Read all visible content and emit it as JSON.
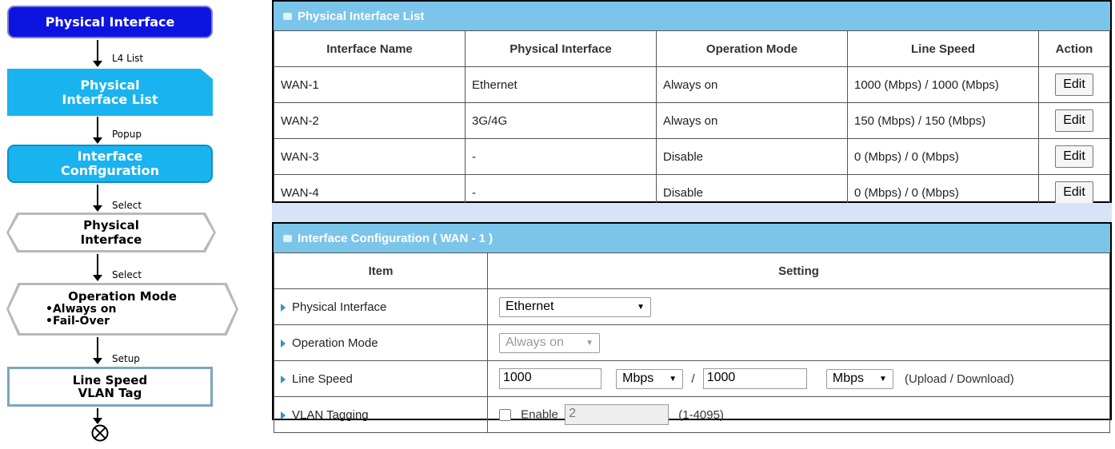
{
  "flow": {
    "step1": "Physical Interface",
    "arrow1": "L4 List",
    "step2_line1": "Physical",
    "step2_line2": "Interface List",
    "arrow2": "Popup",
    "step3_line1": "Interface",
    "step3_line2": "Configuration",
    "arrow3": "Select",
    "step4_line1": "Physical",
    "step4_line2": "Interface",
    "arrow4": "Select",
    "step5_line1": "Operation Mode",
    "step5_bullet1": "•Always on",
    "step5_bullet2": "•Fail-Over",
    "arrow5": "Setup",
    "step6_line1": "Line Speed",
    "step6_line2": "VLAN Tag"
  },
  "list_panel": {
    "title": "Physical Interface List",
    "columns": [
      "Interface Name",
      "Physical Interface",
      "Operation Mode",
      "Line Speed",
      "Action"
    ],
    "rows": [
      {
        "name": "WAN-1",
        "physical": "Ethernet",
        "mode": "Always on",
        "speed": "1000 (Mbps) / 1000 (Mbps)",
        "action": "Edit"
      },
      {
        "name": "WAN-2",
        "physical": "3G/4G",
        "mode": "Always on",
        "speed": "150 (Mbps) / 150 (Mbps)",
        "action": "Edit"
      },
      {
        "name": "WAN-3",
        "physical": "-",
        "mode": "Disable",
        "speed": "0 (Mbps) / 0 (Mbps)",
        "action": "Edit"
      },
      {
        "name": "WAN-4",
        "physical": "-",
        "mode": "Disable",
        "speed": "0 (Mbps) / 0 (Mbps)",
        "action": "Edit"
      }
    ]
  },
  "config_panel": {
    "title": "Interface Configuration ( WAN - 1 )",
    "col_item": "Item",
    "col_setting": "Setting",
    "physical_label": "Physical Interface",
    "physical_value": "Ethernet",
    "mode_label": "Operation Mode",
    "mode_value": "Always on",
    "speed_label": "Line Speed",
    "upload_value": "1000",
    "upload_unit": "Mbps",
    "slash": "/",
    "download_value": "1000",
    "download_unit": "Mbps",
    "speed_note": "(Upload / Download)",
    "vlan_label": "VLAN Tagging",
    "vlan_enable_label": "Enable",
    "vlan_value": "2",
    "vlan_range": "(1-4095)"
  },
  "colors": {
    "panel_header": "#7cc5ea",
    "flow_active": "#0d14e0",
    "flow_blue": "#19b3f0",
    "bullet_arrow": "#2f8fd0"
  }
}
